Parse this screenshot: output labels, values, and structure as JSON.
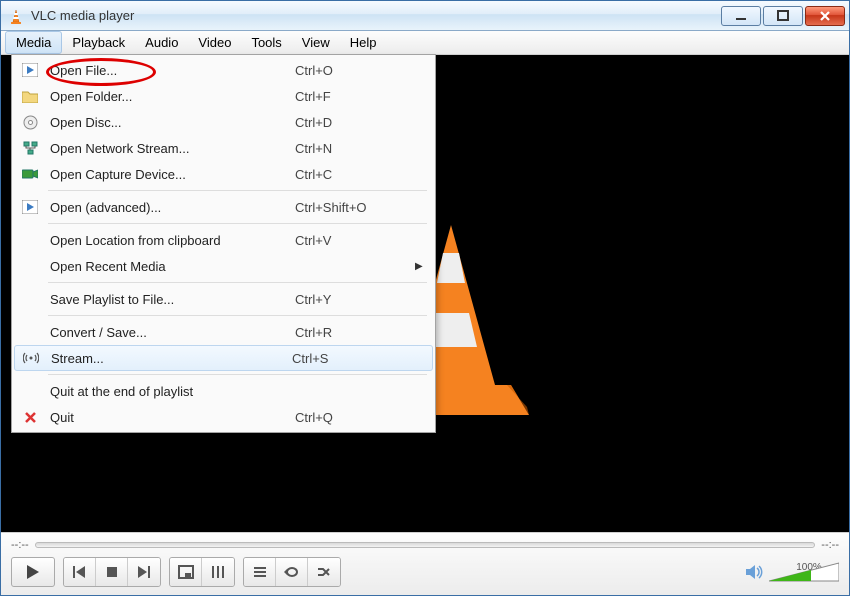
{
  "window": {
    "title": "VLC media player"
  },
  "menubar": [
    "Media",
    "Playback",
    "Audio",
    "Video",
    "Tools",
    "View",
    "Help"
  ],
  "dropdown": {
    "groups": [
      [
        {
          "icon": "play-file",
          "label": "Open File...",
          "shortcut": "Ctrl+O",
          "highlighted": true
        },
        {
          "icon": "folder",
          "label": "Open Folder...",
          "shortcut": "Ctrl+F"
        },
        {
          "icon": "disc",
          "label": "Open Disc...",
          "shortcut": "Ctrl+D"
        },
        {
          "icon": "network",
          "label": "Open Network Stream...",
          "shortcut": "Ctrl+N"
        },
        {
          "icon": "capture",
          "label": "Open Capture Device...",
          "shortcut": "Ctrl+C"
        }
      ],
      [
        {
          "icon": "play-file",
          "label": "Open (advanced)...",
          "shortcut": "Ctrl+Shift+O"
        }
      ],
      [
        {
          "icon": "",
          "label": "Open Location from clipboard",
          "shortcut": "Ctrl+V"
        },
        {
          "icon": "",
          "label": "Open Recent Media",
          "shortcut": "",
          "submenu": true
        }
      ],
      [
        {
          "icon": "",
          "label": "Save Playlist to File...",
          "shortcut": "Ctrl+Y"
        }
      ],
      [
        {
          "icon": "",
          "label": "Convert / Save...",
          "shortcut": "Ctrl+R"
        },
        {
          "icon": "stream",
          "label": "Stream...",
          "shortcut": "Ctrl+S",
          "hover": true
        }
      ],
      [
        {
          "icon": "",
          "label": "Quit at the end of playlist",
          "shortcut": ""
        },
        {
          "icon": "quit",
          "label": "Quit",
          "shortcut": "Ctrl+Q"
        }
      ]
    ]
  },
  "seek": {
    "left": "--:--",
    "right": "--:--"
  },
  "volume": {
    "text": "100%"
  }
}
